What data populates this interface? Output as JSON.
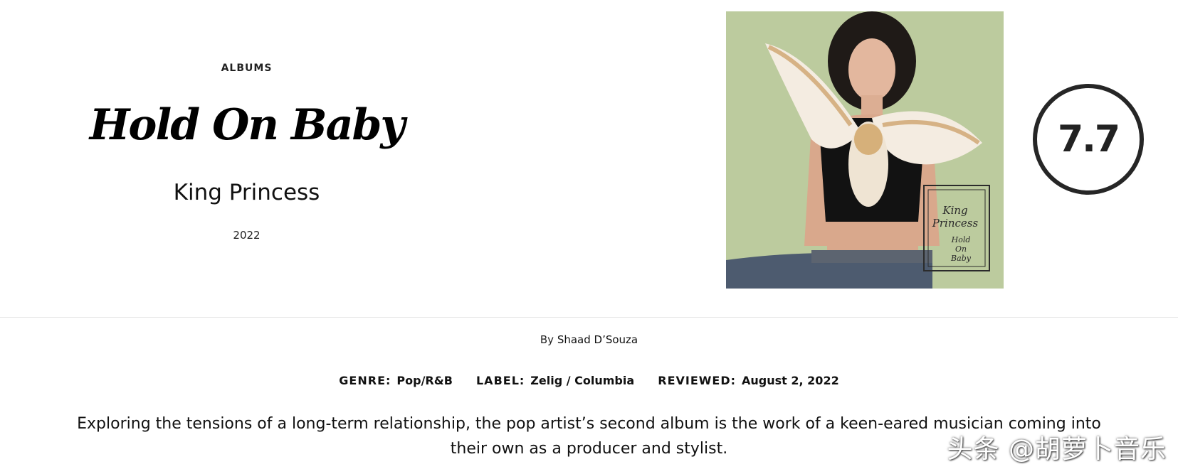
{
  "review": {
    "category": "ALBUMS",
    "title": "Hold On Baby",
    "artist": "King Princess",
    "year": "2022",
    "score": "7.7",
    "cover": {
      "alt": "Hold On Baby album cover",
      "cover_text_artist": "King Princess",
      "cover_text_title": "Hold On Baby"
    },
    "byline_prefix": "By",
    "author": "Shaad D’Souza",
    "genre_label": "GENRE:",
    "genre": "Pop/R&B",
    "label_label": "LABEL:",
    "label": "Zelig / Columbia",
    "reviewed_label": "REVIEWED:",
    "reviewed_date": "August 2, 2022",
    "dek": "Exploring the tensions of a long-term relationship, the pop artist’s second album is the work of a keen-eared musician coming into their own as a producer and stylist."
  },
  "watermark": "头条 @胡萝卜音乐",
  "colors": {
    "score_ring": "#262626",
    "cover_background": "#b7c896",
    "divider": "#e6e6e6"
  }
}
